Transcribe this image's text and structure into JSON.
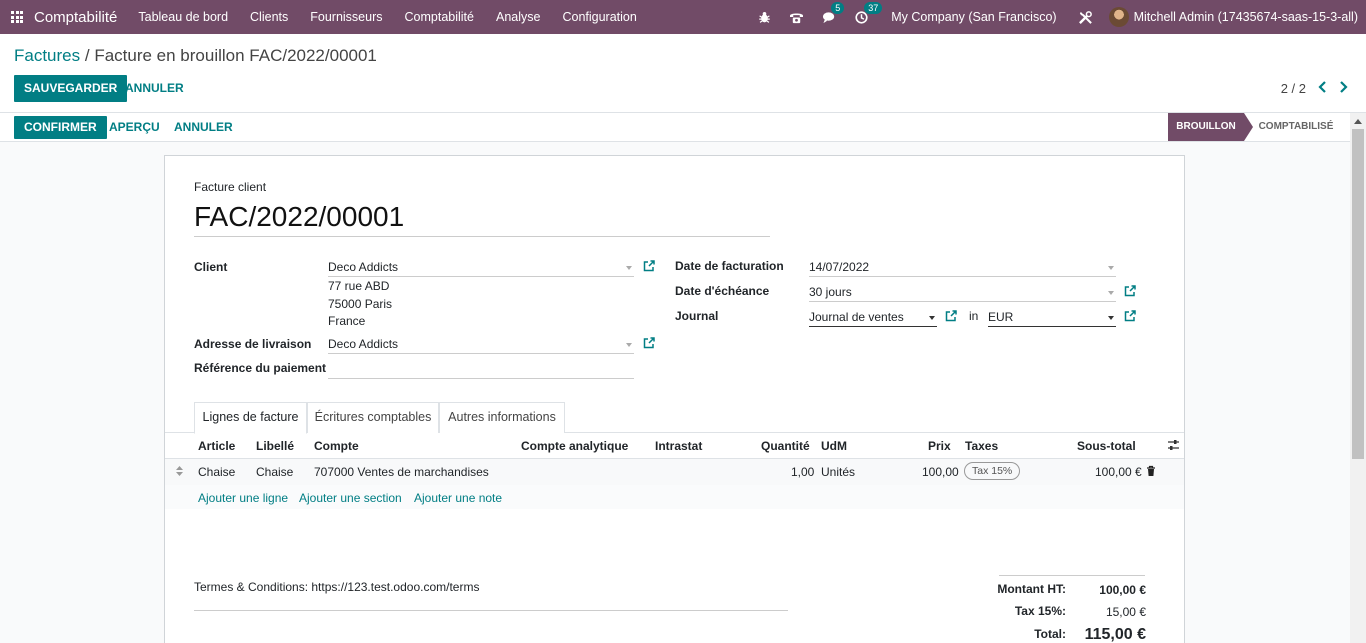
{
  "navbar": {
    "app_title": "Comptabilité",
    "menu": [
      "Tableau de bord",
      "Clients",
      "Fournisseurs",
      "Comptabilité",
      "Analyse",
      "Configuration"
    ],
    "messages_count": "5",
    "activities_count": "37",
    "company": "My Company (San Francisco)",
    "user": "Mitchell Admin (17435674-saas-15-3-all)",
    "icons": [
      "apps-icon",
      "bug-icon",
      "phone-icon",
      "chat-icon",
      "clock-icon",
      "tools-icon",
      "avatar"
    ]
  },
  "breadcrumb": {
    "parent": "Factures",
    "separator": " / ",
    "current": "Facture en brouillon FAC/2022/00001"
  },
  "actions": {
    "save": "SAUVEGARDER",
    "discard": "ANNULER"
  },
  "pager": {
    "value": "2 / 2"
  },
  "statusbar": {
    "confirm": "CONFIRMER",
    "preview": "APERÇU",
    "cancel": "ANNULER",
    "stages": [
      "BROUILLON",
      "COMPTABILISÉ"
    ]
  },
  "form": {
    "move_type": "Facture client",
    "name": "FAC/2022/00001",
    "client_label": "Client",
    "client_value": "Deco Addicts",
    "address_lines": [
      "77 rue ABD",
      "75000 Paris",
      "France"
    ],
    "shipping_label": "Adresse de livraison",
    "shipping_value": "Deco Addicts",
    "payment_ref_label": "Référence du paiement",
    "payment_ref_value": "",
    "invoice_date_label": "Date de facturation",
    "invoice_date_value": "14/07/2022",
    "due_date_label": "Date d'échéance",
    "due_date_value": "30 jours",
    "journal_label": "Journal",
    "journal_value": "Journal de ventes",
    "in_label": "in",
    "currency_value": "EUR"
  },
  "tabs": [
    "Lignes de facture",
    "Écritures comptables",
    "Autres informations"
  ],
  "lines": {
    "headers": [
      "Article",
      "Libellé",
      "Compte",
      "Compte analytique",
      "Intrastat",
      "Quantité",
      "UdM",
      "Prix",
      "Taxes",
      "Sous-total"
    ],
    "rows": [
      {
        "article": "Chaise",
        "label": "Chaise",
        "account": "707000 Ventes de marchandises",
        "analytic": "",
        "intrastat": "",
        "quantity": "1,00",
        "uom": "Unités",
        "price": "100,00",
        "tax": "Tax 15%",
        "subtotal": "100,00 €"
      }
    ],
    "add_line": "Ajouter une ligne",
    "add_section": "Ajouter une section",
    "add_note": "Ajouter une note"
  },
  "terms": "Termes & Conditions: https://123.test.odoo.com/terms",
  "totals": {
    "untaxed_label": "Montant HT:",
    "untaxed_value": "100,00 €",
    "tax_label": "Tax 15%:",
    "tax_value": "15,00 €",
    "total_label": "Total:",
    "total_value": "115,00 €"
  },
  "colors": {
    "brand": "#714b67",
    "accent": "#017e84"
  }
}
